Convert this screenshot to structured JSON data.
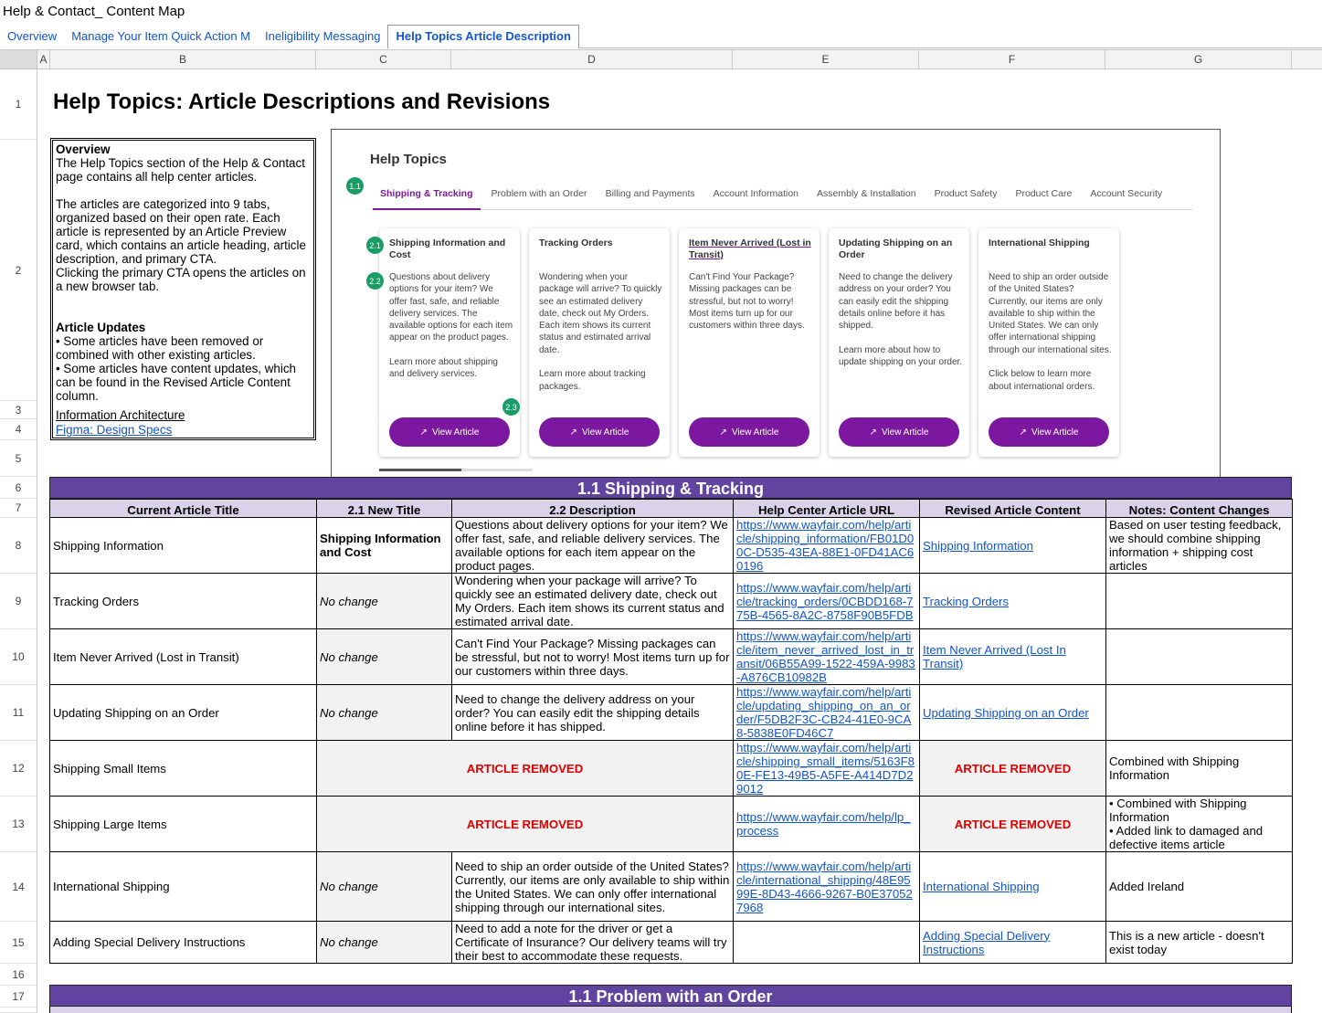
{
  "doc_title": "Help & Contact_ Content Map",
  "tabs": [
    "Overview",
    "Manage Your Item Quick Action M",
    "Ineligibility Messaging",
    "Help Topics Article Description"
  ],
  "active_tab": "Help Topics Article Description",
  "columns": [
    "A",
    "B",
    "C",
    "D",
    "E",
    "F",
    "G"
  ],
  "rows": [
    "1",
    "2",
    "3",
    "4",
    "5",
    "6",
    "7",
    "8",
    "9",
    "10",
    "11",
    "12",
    "13",
    "14",
    "15",
    "16",
    "17"
  ],
  "heading": "Help Topics: Article Descriptions and Revisions",
  "overview": {
    "title": "Overview",
    "p1": "The Help Topics section of the Help & Contact page contains all help center articles.",
    "p2": "The articles are categorized into 9 tabs, organized based on their open rate. Each article is represented by an Article Preview card, which contains an article heading, article description, and primary CTA.",
    "p3": "Clicking the primary CTA opens the articles on a new browser tab.",
    "updates_title": "Article Updates",
    "u1": "• Some articles have been removed or combined with other existing articles.",
    "u2": "• Some articles have content updates, which can be found in the Revised Article Content column.",
    "link1": "Information Architecture",
    "link2": "Figma: Design Specs"
  },
  "mock": {
    "title": "Help Topics",
    "tabs": [
      "Shipping & Tracking",
      "Problem with an Order",
      "Billing and Payments",
      "Account Information",
      "Assembly & Installation",
      "Product Safety",
      "Product Care",
      "Account Security"
    ],
    "badges": [
      "1.1",
      "2.1",
      "2.2",
      "2.3"
    ],
    "button_label": "View Article",
    "cards": [
      {
        "title": "Shipping Information and Cost",
        "desc": "Questions about delivery options for your item? We offer fast, safe, and reliable delivery services. The available options for each item appear on the product pages.\n\nLearn more about shipping and delivery services."
      },
      {
        "title": "Tracking Orders",
        "desc": "Wondering when your package will arrive? To quickly see an estimated delivery date, check out My Orders. Each item shows its current status and estimated arrival date.\n\nLearn more about tracking packages."
      },
      {
        "title": "Item Never Arrived (Lost in Transit)",
        "desc": "Can't Find Your Package? Missing packages can be stressful, but not to worry! Most items turn up for our customers within three days."
      },
      {
        "title": "Updating Shipping on an Order",
        "desc": "Need to change the delivery address on your order? You can easily edit the shipping details online before it has shipped.\n\nLearn more about how to update shipping on your order."
      },
      {
        "title": "International Shipping",
        "desc": "Need to ship an order outside of the United States? Currently, our items are only available to ship within the United States. We can only offer international shipping through our international sites.\n\nClick below to learn more about international orders."
      }
    ]
  },
  "section1": {
    "title": "1.1 Shipping & Tracking",
    "headers": [
      "Current Article Title",
      "2.1 New Title",
      "2.2 Description",
      "Help Center Article URL",
      "Revised Article Content",
      "Notes: Content Changes"
    ],
    "rows": [
      {
        "current": "Shipping Information",
        "new": "Shipping Information and Cost",
        "desc": "Questions about delivery options for your item? We offer fast, safe, and reliable delivery services. The available options for each item appear on the product pages.",
        "url": "https://www.wayfair.com/help/article/shipping_information/FB01D00C-D535-43EA-88E1-0FD41AC60196",
        "revised": "Shipping Information",
        "notes": "Based on user testing feedback, we should combine shipping information + shipping cost articles"
      },
      {
        "current": "Tracking Orders",
        "new": "No change",
        "desc": "Wondering when your package will arrive? To quickly see an estimated delivery date, check out My Orders. Each item shows its current status and estimated arrival date.",
        "url": "https://www.wayfair.com/help/article/tracking_orders/0CBDD168-775B-4565-8A2C-8758F90B5FDB",
        "revised": "Tracking Orders",
        "notes": ""
      },
      {
        "current": "Item Never Arrived (Lost in Transit)",
        "new": "No change",
        "desc": "Can't Find Your Package? Missing packages can be stressful, but not to worry! Most items turn up for our customers within three days.",
        "url": "https://www.wayfair.com/help/article/item_never_arrived_lost_in_transit/06B55A99-1522-459A-9983-A876CB10982B",
        "revised": "Item Never Arrived (Lost In Transit)",
        "notes": ""
      },
      {
        "current": "Updating Shipping on an Order",
        "new": "No change",
        "desc": "Need to change the delivery address on your order? You can easily edit the shipping details online before it has shipped.",
        "url": "https://www.wayfair.com/help/article/updating_shipping_on_an_order/F5DB2F3C-CB24-41E0-9CA8-5838E0FD46C7",
        "revised": "Updating Shipping on an Order",
        "notes": ""
      },
      {
        "current": "Shipping Small Items",
        "removed": "ARTICLE REMOVED",
        "url": "https://www.wayfair.com/help/article/shipping_small_items/5163F80E-FE13-49B5-A5FE-A414D7D29012",
        "revised_removed": "ARTICLE REMOVED",
        "notes": "Combined with Shipping Information"
      },
      {
        "current": "Shipping Large Items",
        "removed": "ARTICLE REMOVED",
        "url": "https://www.wayfair.com/help/lp_process",
        "revised_removed": "ARTICLE REMOVED",
        "notes": "• Combined with Shipping Information\n• Added link to damaged and defective items article"
      },
      {
        "current": "International Shipping",
        "new": "No change",
        "desc": "Need to ship an order outside of the United States? Currently, our items are only available to ship within the United States. We can only offer international shipping through our international sites.",
        "url": "https://www.wayfair.com/help/article/international_shipping/48E9599E-8D43-4666-9267-B0E370527968",
        "revised": "International Shipping",
        "notes": "Added Ireland"
      },
      {
        "current": "Adding Special Delivery Instructions",
        "new": "No change",
        "desc": "Need to add a note for the driver or get a Certificate of Insurance? Our delivery teams will try their best to accommodate these requests.",
        "url": "",
        "revised": "Adding Special Delivery Instructions",
        "notes": "This is a new article - doesn't exist today"
      }
    ]
  },
  "section2": {
    "title": "1.1 Problem with an Order"
  }
}
